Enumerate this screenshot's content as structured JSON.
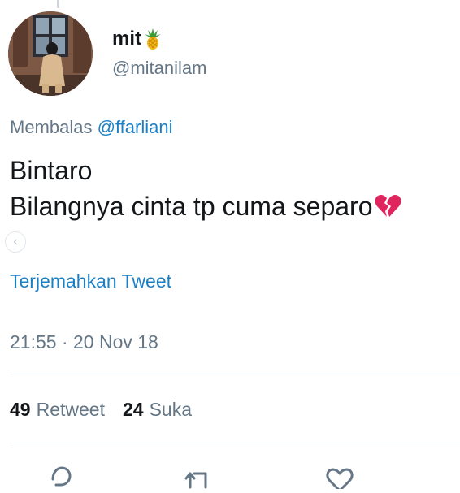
{
  "author": {
    "display_name": "mit",
    "name_emoji": "pineapple-emoji",
    "handle": "@mitanilam"
  },
  "reply": {
    "prefix": "Membalas",
    "mention": "@ffarliani"
  },
  "tweet": {
    "line1": "Bintaro",
    "line2": "Bilangnya cinta tp cuma separo",
    "emoji": "broken-heart-emoji"
  },
  "translate_label": "Terjemahkan Tweet",
  "timestamp": "21:55 · 20 Nov 18",
  "stats": {
    "retweet_count": "49",
    "retweet_label": "Retweet",
    "like_count": "24",
    "like_label": "Suka"
  },
  "actions": [
    "reply-icon",
    "retweet-icon",
    "like-icon"
  ],
  "colors": {
    "link": "#1b7fc6",
    "muted": "#657786",
    "text": "#14171a",
    "divider": "#e1e8ed",
    "heart": "#e0245e"
  }
}
